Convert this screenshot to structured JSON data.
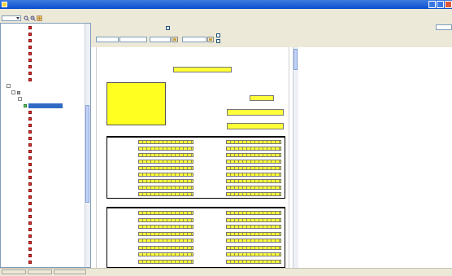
{
  "window": {
    "title": "",
    "colors": {
      "titlebar": "#0a4fd0",
      "form_field": "#ffff3a",
      "selection": "#316ac5",
      "link_title": "#1a3a9c"
    }
  },
  "menu": [
    {
      "label": ""
    },
    {
      "label": ""
    },
    {
      "label": ""
    },
    {
      "label": ""
    },
    {
      "label": ""
    },
    {
      "label": ""
    }
  ],
  "toolbar": {
    "zoom_value": "",
    "icons": [
      "app-icon",
      "zoom-in-icon",
      "zoom-out-icon",
      "grid-icon"
    ]
  },
  "tree": {
    "items": [
      {
        "label": "",
        "icon": "red"
      },
      {
        "label": "",
        "icon": "red"
      },
      {
        "label": "",
        "icon": "red"
      },
      {
        "label": "",
        "icon": "red"
      },
      {
        "label": "",
        "icon": "red"
      },
      {
        "label": "",
        "icon": "red"
      },
      {
        "label": "",
        "icon": "red"
      },
      {
        "label": "",
        "icon": "red"
      },
      {
        "label": "",
        "icon": "red"
      },
      {
        "label": "",
        "icon": "none"
      },
      {
        "label": "",
        "icon": "gray"
      },
      {
        "label": "",
        "icon": "none"
      },
      {
        "label": "",
        "icon": "green",
        "selected": true
      },
      {
        "label": "",
        "icon": "red"
      },
      {
        "label": "",
        "icon": "red"
      },
      {
        "label": "",
        "icon": "red"
      },
      {
        "label": "",
        "icon": "red"
      },
      {
        "label": "",
        "icon": "red"
      },
      {
        "label": "",
        "icon": "red"
      },
      {
        "label": "",
        "icon": "red"
      },
      {
        "label": "",
        "icon": "red"
      },
      {
        "label": "",
        "icon": "red"
      },
      {
        "label": "",
        "icon": "red"
      },
      {
        "label": "",
        "icon": "red"
      },
      {
        "label": "",
        "icon": "red"
      },
      {
        "label": "",
        "icon": "red"
      },
      {
        "label": "",
        "icon": "red"
      },
      {
        "label": "",
        "icon": "red"
      },
      {
        "label": "",
        "icon": "red"
      },
      {
        "label": "",
        "icon": "red"
      },
      {
        "label": "",
        "icon": "red"
      },
      {
        "label": "",
        "icon": "red"
      },
      {
        "label": "",
        "icon": "red"
      },
      {
        "label": "",
        "icon": "red"
      },
      {
        "label": "",
        "icon": "red"
      },
      {
        "label": "",
        "icon": "red"
      },
      {
        "label": "",
        "icon": "red"
      }
    ]
  },
  "properties": {
    "title": "",
    "allow_overlap_label": "",
    "do_not_match_label": "",
    "fields": [
      {
        "label": "",
        "value": ""
      },
      {
        "label": "",
        "value": ""
      },
      {
        "label": "",
        "value": ""
      },
      {
        "label": "",
        "value": ""
      }
    ],
    "right_box_value": ""
  },
  "form": {
    "title": "",
    "subtitle": "",
    "period_label": "",
    "section1_title": "",
    "section1_note": "",
    "section2_title": "",
    "section2_note": "",
    "right_labels": [
      "",
      "",
      ""
    ]
  },
  "statusbar": {
    "panes": [
      "",
      "",
      ""
    ]
  }
}
